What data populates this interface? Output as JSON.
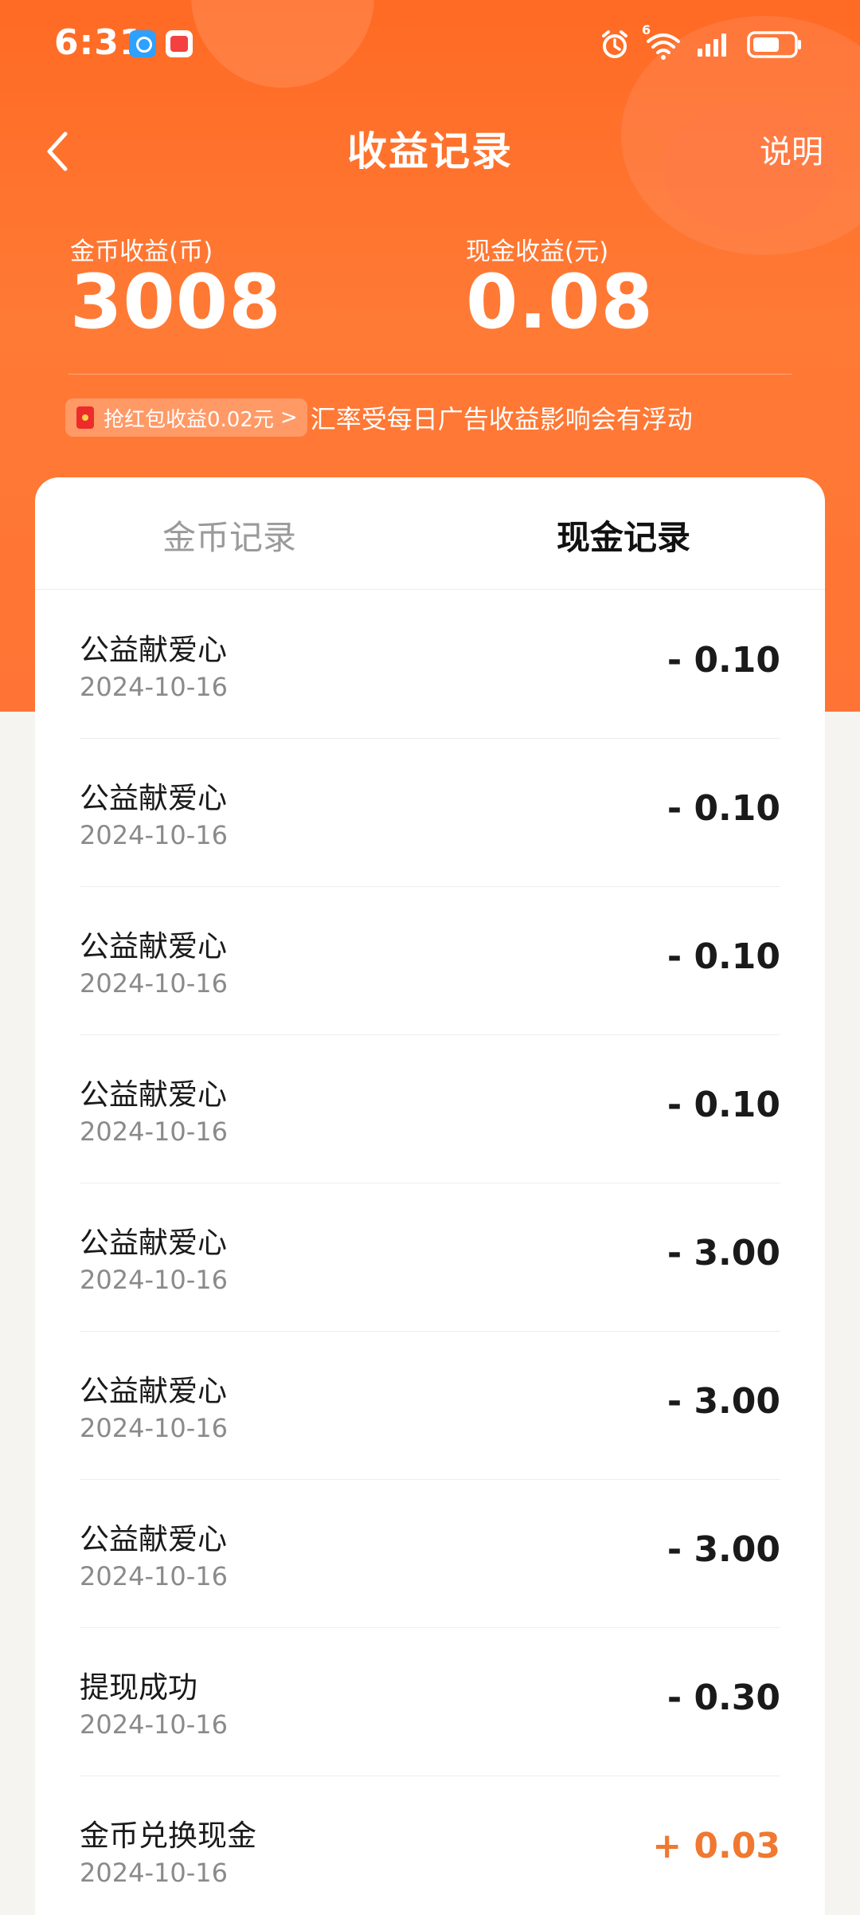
{
  "status_bar": {
    "time": "6:31",
    "network_badge": "6"
  },
  "header": {
    "title": "收益记录",
    "explain_label": "说明"
  },
  "summary": {
    "coin_label": "金币收益(币)",
    "coin_value": "3008",
    "cash_label": "现金收益(元)",
    "cash_value": "0.08"
  },
  "tip": {
    "chip_label": "抢红包收益0.02元",
    "chevron": ">",
    "text": "汇率受每日广告收益影响会有浮动"
  },
  "tabs": [
    {
      "label": "金币记录",
      "active": false
    },
    {
      "label": "现金记录",
      "active": true
    }
  ],
  "records": [
    {
      "title": "公益献爱心",
      "date": "2024-10-16",
      "amount": "- 0.10"
    },
    {
      "title": "公益献爱心",
      "date": "2024-10-16",
      "amount": "- 0.10"
    },
    {
      "title": "公益献爱心",
      "date": "2024-10-16",
      "amount": "- 0.10"
    },
    {
      "title": "公益献爱心",
      "date": "2024-10-16",
      "amount": "- 0.10"
    },
    {
      "title": "公益献爱心",
      "date": "2024-10-16",
      "amount": "- 3.00"
    },
    {
      "title": "公益献爱心",
      "date": "2024-10-16",
      "amount": "- 3.00"
    },
    {
      "title": "公益献爱心",
      "date": "2024-10-16",
      "amount": "- 3.00"
    },
    {
      "title": "提现成功",
      "date": "2024-10-16",
      "amount": "- 0.30"
    },
    {
      "title": "金币兑换现金",
      "date": "2024-10-16",
      "amount": "+ 0.03"
    }
  ],
  "colors": {
    "header_orange": "#ff6a24",
    "positive_amount": "#f07830",
    "text_primary": "#1a1a1a",
    "text_secondary": "#8a8a8a"
  },
  "icons": [
    "search-app-icon",
    "mail-app-icon",
    "alarm-icon",
    "wifi-icon",
    "signal-icon",
    "battery-icon",
    "back-arrow-icon",
    "red-packet-icon",
    "chevron-right-icon"
  ]
}
